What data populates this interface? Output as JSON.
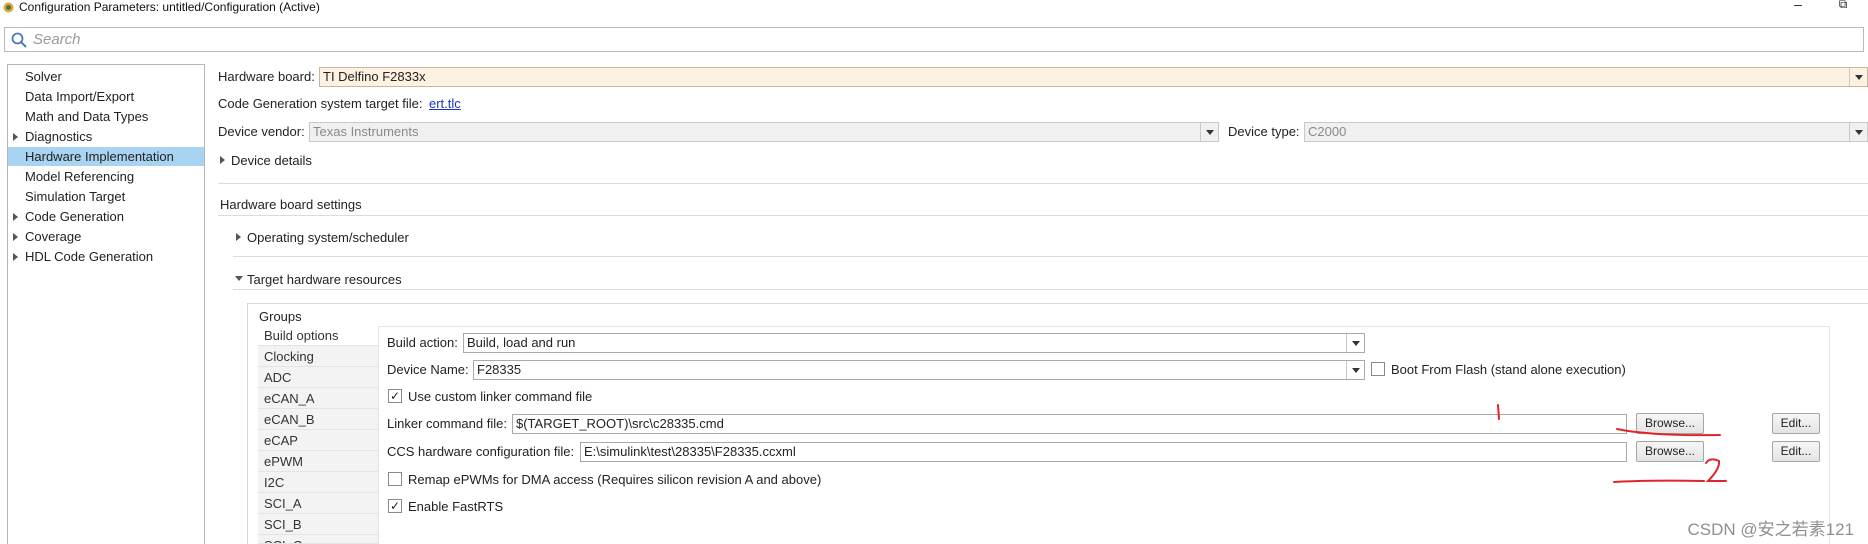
{
  "window": {
    "title": "Configuration Parameters: untitled/Configuration (Active)",
    "minimize": "–",
    "maximize": "⧉"
  },
  "search": {
    "placeholder": "Search"
  },
  "tree": {
    "items": [
      {
        "label": "Solver",
        "expandable": false
      },
      {
        "label": "Data Import/Export",
        "expandable": false
      },
      {
        "label": "Math and Data Types",
        "expandable": false
      },
      {
        "label": "Diagnostics",
        "expandable": true
      },
      {
        "label": "Hardware Implementation",
        "expandable": false,
        "selected": true
      },
      {
        "label": "Model Referencing",
        "expandable": false
      },
      {
        "label": "Simulation Target",
        "expandable": false
      },
      {
        "label": "Code Generation",
        "expandable": true
      },
      {
        "label": "Coverage",
        "expandable": true
      },
      {
        "label": "HDL Code Generation",
        "expandable": true
      }
    ]
  },
  "hardware": {
    "board_label": "Hardware board:",
    "board_value": "TI Delfino F2833x",
    "codegen_label": "Code Generation system target file:",
    "codegen_link": "ert.tlc",
    "vendor_label": "Device vendor:",
    "vendor_value": "Texas Instruments",
    "type_label": "Device type:",
    "type_value": "C2000",
    "device_details": "Device details",
    "board_settings": "Hardware board settings",
    "os_scheduler": "Operating system/scheduler",
    "target_resources": "Target hardware resources"
  },
  "groups": {
    "title": "Groups",
    "items": [
      "Build options",
      "Clocking",
      "ADC",
      "eCAN_A",
      "eCAN_B",
      "eCAP",
      "ePWM",
      "I2C",
      "SCI_A",
      "SCI_B",
      "SCI_C"
    ]
  },
  "build": {
    "action_label": "Build action:",
    "action_value": "Build, load and run",
    "device_name_label": "Device Name:",
    "device_name_value": "F28335",
    "boot_flash_label": "Boot From Flash (stand alone execution)",
    "boot_flash_checked": false,
    "custom_linker_label": "Use custom linker command file",
    "custom_linker_checked": true,
    "linker_label": "Linker command file:",
    "linker_value": "$(TARGET_ROOT)\\src\\c28335.cmd",
    "ccs_label": "CCS hardware configuration file:",
    "ccs_value": "E:\\simulink\\test\\28335\\F28335.ccxml",
    "browse": "Browse...",
    "edit": "Edit...",
    "remap_label": "Remap ePWMs for DMA access (Requires silicon revision A and above)",
    "remap_checked": false,
    "fastrts_label": "Enable FastRTS",
    "fastrts_checked": true
  },
  "annotations": {
    "mark1": "1",
    "mark2": "2",
    "color": "#e0242a"
  },
  "watermark": "CSDN @安之若素121",
  "colors": {
    "selection": "#a8d4f2",
    "board_field": "#fdf1e1",
    "link": "#1a34c4"
  }
}
